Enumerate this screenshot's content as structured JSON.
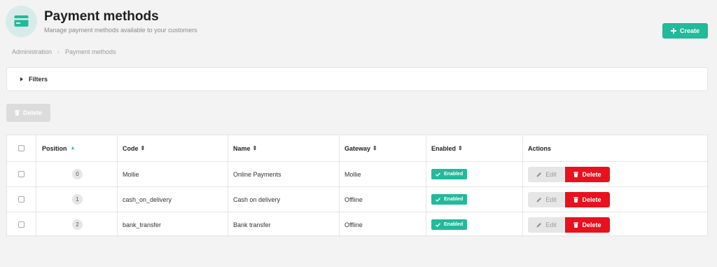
{
  "header": {
    "title": "Payment methods",
    "subtitle": "Manage payment methods available to your customers",
    "create_label": "Create"
  },
  "breadcrumb": {
    "items": [
      "Administration",
      "Payment methods"
    ]
  },
  "filters": {
    "label": "Filters"
  },
  "bulk_actions": {
    "delete_label": "Delete"
  },
  "table": {
    "columns": [
      "Position",
      "Code",
      "Name",
      "Gateway",
      "Enabled",
      "Actions"
    ],
    "rows": [
      {
        "position": "0",
        "code": "Mollie",
        "name": "Online Payments",
        "gateway": "Mollie",
        "enabled": "Enabled"
      },
      {
        "position": "1",
        "code": "cash_on_delivery",
        "name": "Cash on delivery",
        "gateway": "Offline",
        "enabled": "Enabled"
      },
      {
        "position": "2",
        "code": "bank_transfer",
        "name": "Bank transfer",
        "gateway": "Offline",
        "enabled": "Enabled"
      }
    ],
    "edit_label": "Edit",
    "delete_label": "Delete"
  },
  "colors": {
    "accent": "#21ba9a",
    "danger": "#e8121e",
    "background": "#f3f3f3"
  },
  "icons": [
    "credit-card-icon",
    "plus-icon",
    "caret-right-icon",
    "trash-icon",
    "sort-asc-icon",
    "sort-icon",
    "check-icon",
    "pencil-icon"
  ]
}
